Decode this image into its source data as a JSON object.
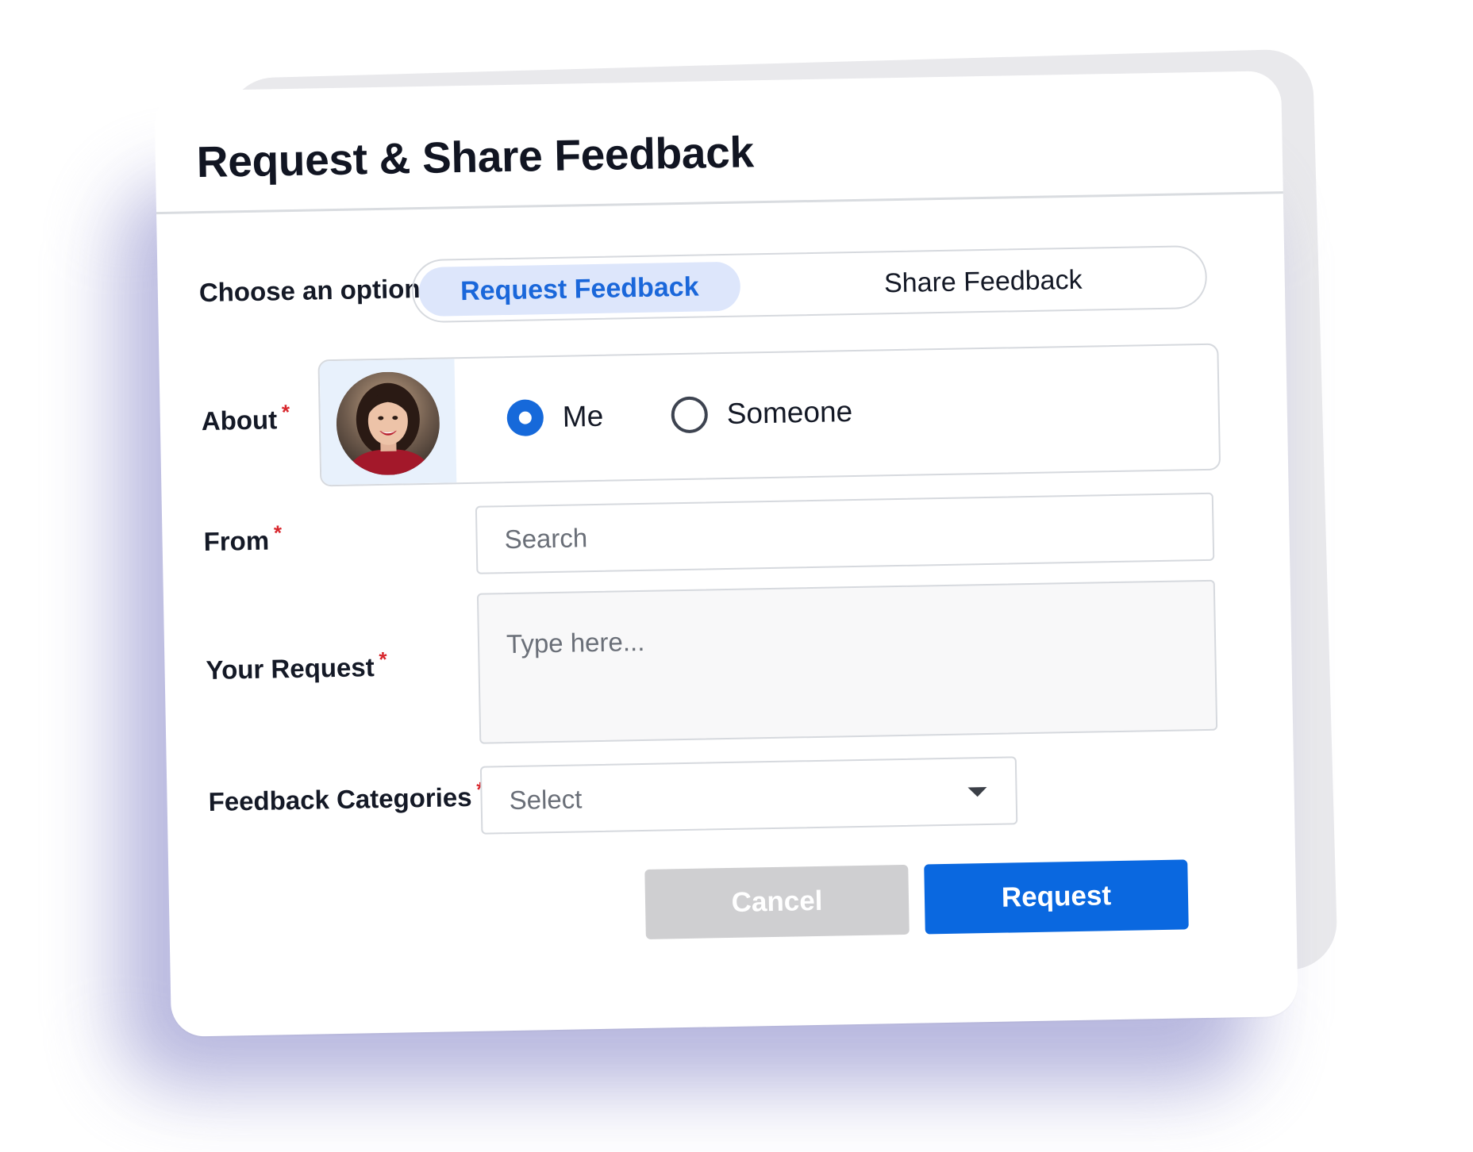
{
  "dialog": {
    "title": "Request & Share Feedback"
  },
  "option": {
    "label": "Choose an option",
    "choices": [
      "Request Feedback",
      "Share Feedback"
    ],
    "selected": "Request Feedback"
  },
  "about": {
    "label": "About",
    "required_mark": "*",
    "options": [
      "Me",
      "Someone"
    ],
    "selected": "Me"
  },
  "from": {
    "label": "From",
    "required_mark": "*",
    "placeholder": "Search"
  },
  "request": {
    "label": "Your Request",
    "required_mark": "*",
    "placeholder": "Type here..."
  },
  "categories": {
    "label": "Feedback Categories",
    "required_mark": "*",
    "placeholder": "Select"
  },
  "buttons": {
    "cancel": "Cancel",
    "submit": "Request"
  },
  "colors": {
    "accent": "#0a68e0",
    "active_tab_bg": "#dde6fb",
    "required": "#d8262c",
    "disabled_button": "#cfcfd1"
  },
  "icons": {
    "select_caret": "chevron-down-icon",
    "avatar": "user-avatar"
  }
}
